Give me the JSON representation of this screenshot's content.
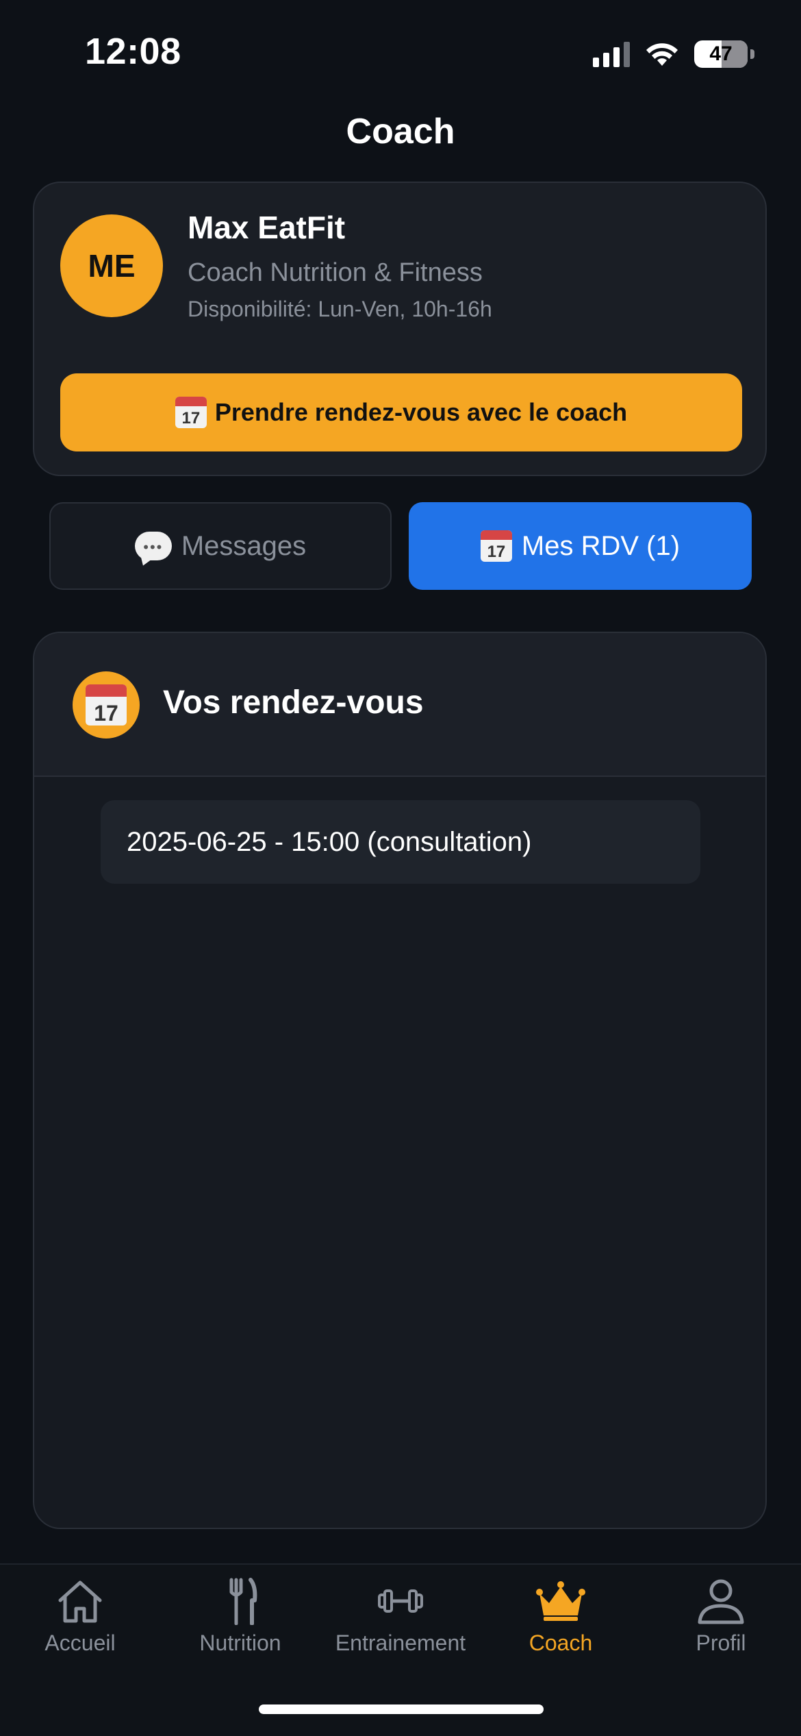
{
  "status_bar": {
    "time": "12:08",
    "battery": "47"
  },
  "header": {
    "title": "Coach"
  },
  "coach": {
    "initials": "ME",
    "name": "Max EatFit",
    "role": "Coach Nutrition & Fitness",
    "availability": "Disponibilité: Lun-Ven, 10h-16h",
    "book_button": "Prendre rendez-vous avec le coach"
  },
  "segments": {
    "messages": "Messages",
    "appointments": "Mes RDV (1)",
    "active": "appointments"
  },
  "appointments_panel": {
    "title": "Vos rendez-vous",
    "items": [
      "2025-06-25 - 15:00 (consultation)"
    ]
  },
  "calendar_glyph_day": "17",
  "tab_bar": {
    "active": "coach",
    "items": [
      {
        "label": "Accueil",
        "icon": "home-icon"
      },
      {
        "label": "Nutrition",
        "icon": "fork-knife-icon"
      },
      {
        "label": "Entrainement",
        "icon": "dumbbell-icon"
      },
      {
        "label": "Coach",
        "icon": "crown-icon"
      },
      {
        "label": "Profil",
        "icon": "user-icon"
      }
    ]
  },
  "colors": {
    "background": "#0d1117",
    "accent_orange": "#f5a623",
    "accent_blue": "#2173e8",
    "muted_text": "#8b919b"
  }
}
